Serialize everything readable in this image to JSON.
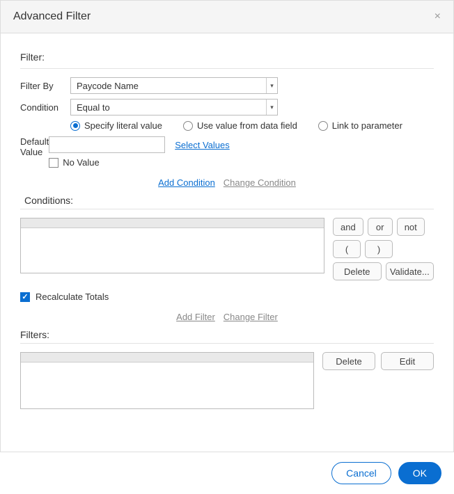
{
  "dialog": {
    "title": "Advanced Filter"
  },
  "filter_section": {
    "heading": "Filter:",
    "filter_by_label": "Filter By",
    "filter_by_value": "Paycode Name",
    "condition_label": "Condition",
    "condition_value": "Equal to",
    "value_source": {
      "literal": "Specify literal value",
      "data_field": "Use value from data field",
      "link_param": "Link to parameter",
      "selected": "literal"
    },
    "default_value_label_line1": "Default",
    "default_value_label_line2": "Value",
    "default_value": "",
    "select_values_link": "Select Values",
    "no_value_label": "No Value",
    "no_value_checked": false,
    "add_condition_link": "Add Condition",
    "change_condition_link": "Change Condition"
  },
  "conditions_section": {
    "heading": "Conditions:",
    "items": [],
    "buttons": {
      "and": "and",
      "or": "or",
      "not": "not",
      "lparen": "(",
      "rparen": ")",
      "delete": "Delete",
      "validate": "Validate..."
    }
  },
  "recalc": {
    "label": "Recalculate Totals",
    "checked": true
  },
  "filter_links": {
    "add_filter": "Add Filter",
    "change_filter": "Change Filter"
  },
  "filters_section": {
    "heading": "Filters:",
    "items": [],
    "buttons": {
      "delete": "Delete",
      "edit": "Edit"
    }
  },
  "footer": {
    "cancel": "Cancel",
    "ok": "OK"
  }
}
